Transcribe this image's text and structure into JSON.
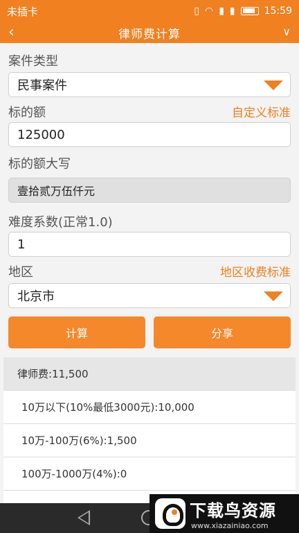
{
  "status": {
    "carrier": "未插卡",
    "time": "15:59",
    "icons": [
      "vibrate-icon",
      "wifi-icon",
      "sim1-icon",
      "sim2-icon",
      "battery-icon"
    ]
  },
  "header": {
    "back_icon": "‹",
    "title": "律师费计算",
    "menu_icon": "∨"
  },
  "form": {
    "case_type_label": "案件类型",
    "case_type_value": "民事案件",
    "amount_label": "标的额",
    "custom_standard_link": "自定义标准",
    "amount_value": "125000",
    "amount_caps_label": "标的额大写",
    "amount_caps_value": "壹拾贰万伍仟元",
    "difficulty_label": "难度系数(正常1.0)",
    "difficulty_value": "1",
    "region_label": "地区",
    "region_standard_link": "地区收费标准",
    "region_value": "北京市"
  },
  "buttons": {
    "calculate": "计算",
    "share": "分享"
  },
  "results": {
    "total": "律师费:11,500",
    "rows": [
      "10万以下(10%最低3000元):10,000",
      "10万-100万(6%):1,500",
      "100万-1000万(4%):0"
    ]
  },
  "watermark": {
    "main": "下载鸟资源",
    "sub": "www.xiazainiao.com"
  },
  "colors": {
    "accent": "#f08020",
    "button": "#f5882a"
  }
}
